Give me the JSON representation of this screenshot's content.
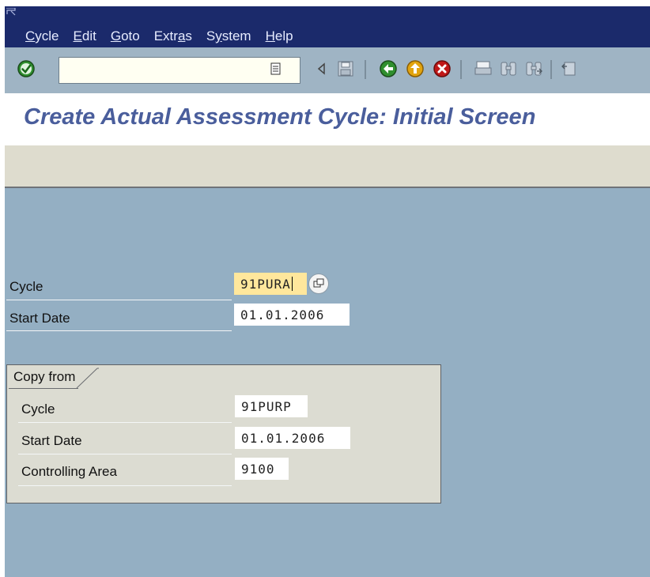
{
  "menu": {
    "items": [
      {
        "before": "",
        "key": "C",
        "after": "ycle"
      },
      {
        "before": "",
        "key": "E",
        "after": "dit"
      },
      {
        "before": "",
        "key": "G",
        "after": "oto"
      },
      {
        "before": "Extr",
        "key": "a",
        "after": "s"
      },
      {
        "before": "S",
        "key": "y",
        "after": "stem"
      },
      {
        "before": "",
        "key": "H",
        "after": "elp"
      }
    ]
  },
  "toolbar": {
    "command_field": {
      "value": "",
      "placeholder": ""
    },
    "icons": [
      "enter-icon",
      "back-nav-icon",
      "save-icon",
      "back-icon",
      "exit-icon",
      "cancel-icon",
      "print-icon",
      "find-icon",
      "find-next-icon",
      "first-page-icon"
    ],
    "colors": {
      "green": "#2f8f2f",
      "yellow": "#e2a40e",
      "red": "#c01818"
    }
  },
  "page": {
    "title": "Create Actual Assessment Cycle: Initial Screen"
  },
  "form": {
    "cycle": {
      "label": "Cycle",
      "value": "91PURA"
    },
    "start_date": {
      "label": "Start Date",
      "value": "01.01.2006"
    }
  },
  "copy_from": {
    "title": "Copy from",
    "cycle": {
      "label": "Cycle",
      "value": "91PURP"
    },
    "start_date": {
      "label": "Start Date",
      "value": "01.01.2006"
    },
    "controlling_area": {
      "label": "Controlling Area",
      "value": "9100"
    }
  }
}
